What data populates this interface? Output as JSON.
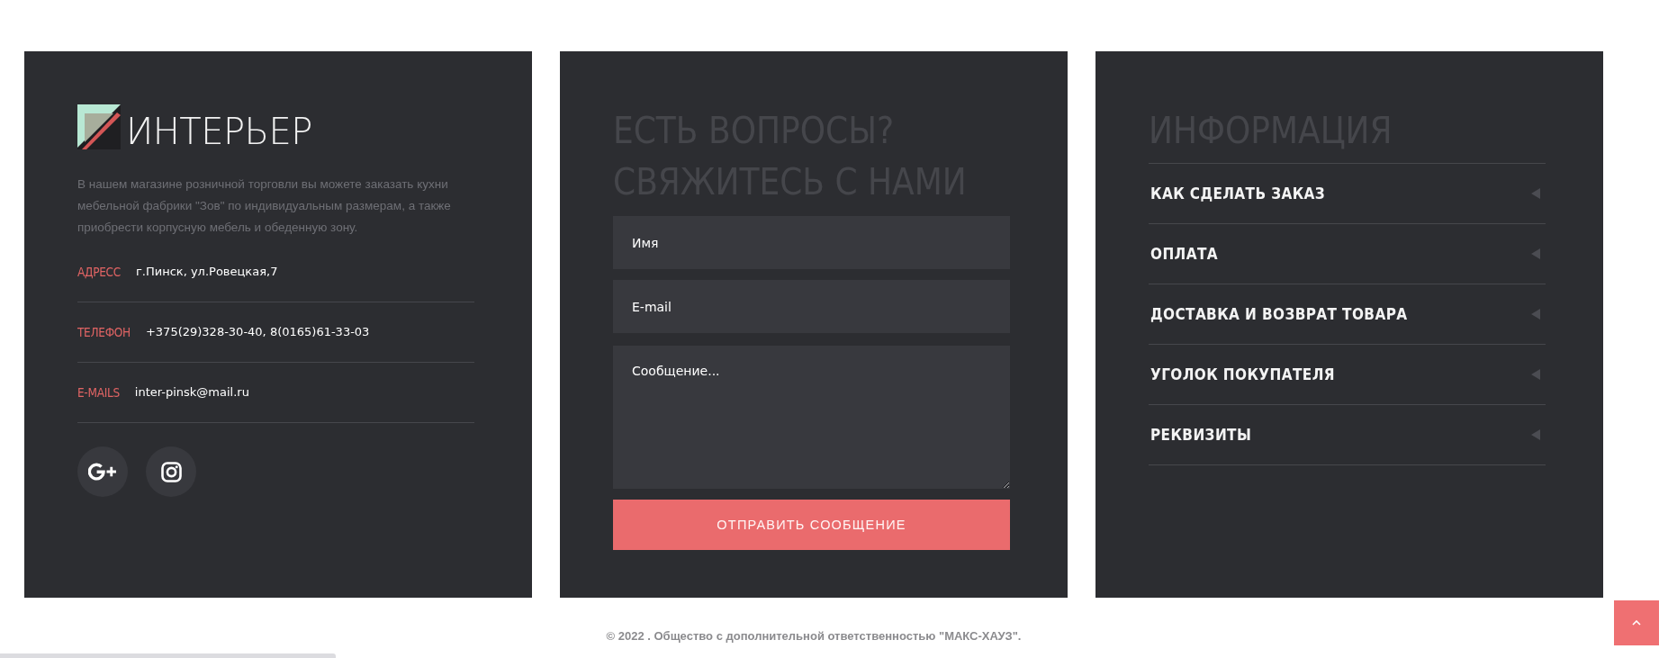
{
  "brand": {
    "name": "ИНТЕРЬЕР",
    "description": "В нашем магазине розничной торговли вы можете заказать кухни мебельной фабрики \"Зов\" по индивидуальным размерам, а также приобрести корпусную мебель и обеденную зону."
  },
  "contacts": [
    {
      "label": "АДРЕСС",
      "value": "г.Пинск, ул.Ровецкая,7"
    },
    {
      "label": "ТЕЛЕФОН",
      "value": "+375(29)328-30-40, 8(0165)61-33-03"
    },
    {
      "label": "E-MAILS",
      "value": "inter-pinsk@mail.ru"
    }
  ],
  "social_links": [
    {
      "kind": "gplus"
    },
    {
      "kind": "camera"
    }
  ],
  "contact_form": {
    "title": "ЕСТЬ ВОПРОСЫ? СВЯЖИТЕСЬ С НАМИ",
    "fields": [
      {
        "kind": "input",
        "placeholder": "Имя"
      },
      {
        "kind": "input",
        "placeholder": "E-mail"
      },
      {
        "kind": "textarea",
        "placeholder": "Сообщение..."
      }
    ],
    "submit_label": "ОТПРАВИТЬ СООБЩЕНИЕ"
  },
  "info": {
    "title": "ИНФОРМАЦИЯ",
    "items": [
      "КАК СДЕЛАТЬ ЗАКАЗ",
      "ОПЛАТА",
      "ДОСТАВКА И ВОЗВРАТ ТОВАРА",
      "УГОЛОК ПОКУПАТЕЛЯ",
      "РЕКВИЗИТЫ"
    ]
  },
  "footer": {
    "copyright": "© 2022 . Общество с дополнительной ответственностью \"МАКС-ХАУЗ\"."
  }
}
